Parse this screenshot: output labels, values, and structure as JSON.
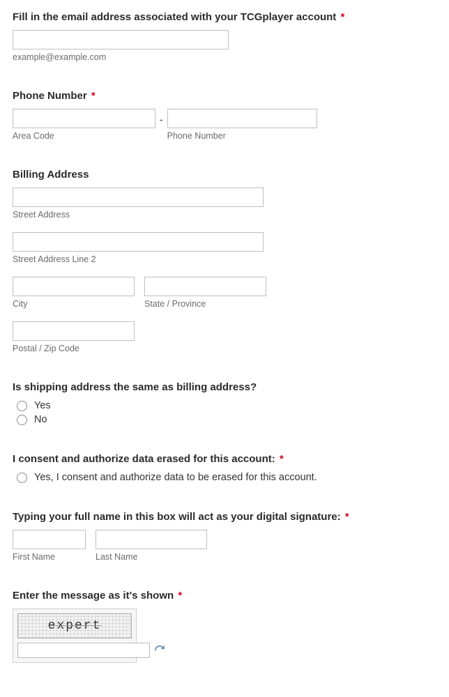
{
  "email": {
    "label": "Fill in the email address associated with your TCGplayer account",
    "required": true,
    "helper": "example@example.com"
  },
  "phone": {
    "label": "Phone Number",
    "required": true,
    "separator": "-",
    "area_sub": "Area Code",
    "num_sub": "Phone Number"
  },
  "billing": {
    "label": "Billing Address",
    "street_sub": "Street Address",
    "street2_sub": "Street Address Line 2",
    "city_sub": "City",
    "state_sub": "State / Province",
    "postal_sub": "Postal / Zip Code"
  },
  "shipping_same": {
    "label": "Is shipping address the same as billing address?",
    "opt_yes": "Yes",
    "opt_no": "No"
  },
  "consent": {
    "label": "I consent and authorize data erased for this account:",
    "required": true,
    "opt_yes": "Yes, I consent and authorize data to be erased for this account."
  },
  "signature": {
    "label": "Typing your full name in this box will act as your digital signature:",
    "required": true,
    "first_sub": "First Name",
    "last_sub": "Last Name"
  },
  "captcha": {
    "label": "Enter the message as it's shown",
    "required": true,
    "text": "expert"
  },
  "asterisk": "*"
}
